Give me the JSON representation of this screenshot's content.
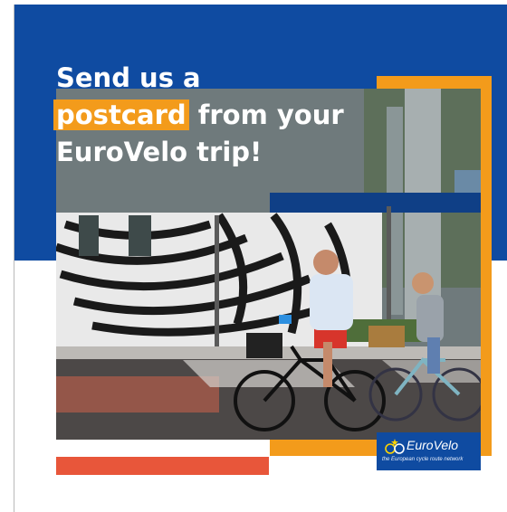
{
  "headline": {
    "line1": "Send us a",
    "highlight": "postcard",
    "line2_rest": " from your",
    "line3": "EuroVelo trip!"
  },
  "logo": {
    "name": "EuroVelo",
    "tagline": "the European cycle route network"
  },
  "colors": {
    "brand_blue": "#0f4ba1",
    "accent_orange": "#f39b1b",
    "accent_red": "#e8563a"
  },
  "photo": {
    "icon": "cyclists-photo"
  }
}
